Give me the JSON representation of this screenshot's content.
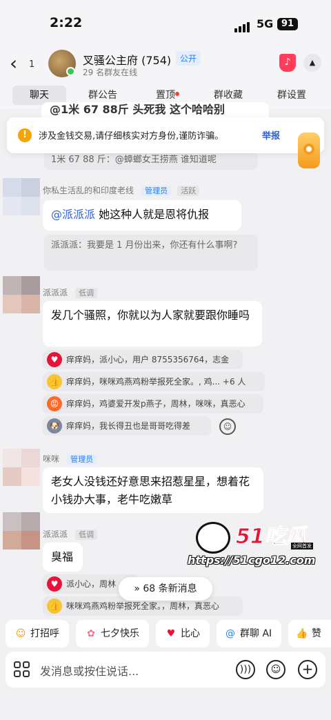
{
  "status_bar": {
    "time": "2:22",
    "network": "5G",
    "battery": "91"
  },
  "header": {
    "back_count": "1",
    "group_name": "叉骚公主府 (754)",
    "public_badge": "公开",
    "online": "29 名群友在线"
  },
  "tabs": [
    {
      "label": "聊天",
      "active": true
    },
    {
      "label": "群公告"
    },
    {
      "label": "置顶",
      "has_dot": true
    },
    {
      "label": "群收藏"
    },
    {
      "label": "群设置"
    }
  ],
  "warning": {
    "text": "涉及金钱交易,请仔细核实对方身份,谨防诈骗。",
    "link": "举报"
  },
  "messages": {
    "top_partial_quote": "1米 67 88 斤：@蟑螂女王捞燕 谁知道呢",
    "top_partial_text": "@1米 67 88斤 头死我 这个哈哈别",
    "m1": {
      "sender": "你私生活乱的和印度老线",
      "tag1": "管理员",
      "tag2": "活跃",
      "mention": "@派派派",
      "text": "她这种人就是恩将仇报",
      "quote": "派派派：我要是 1 月份出来，你还有什么事啊?"
    },
    "m2": {
      "sender": "派派派",
      "tag": "低调",
      "text": "发几个骚照，你就以为人家就要跟你睡吗",
      "reactions": [
        {
          "icon": "heart-icon",
          "text": "痒痒妈，派小心，用户 8755356764，志金"
        },
        {
          "icon": "thumbs-up-icon",
          "text": "痒痒妈，咪咪鸡燕鸡粉举报死全家。, 鸡... +6 人"
        },
        {
          "icon": "angry-face-icon",
          "text": "痒痒妈，鸡婆爱开发p燕子，周林，咪咪，真恶心"
        },
        {
          "icon": "dog-face-icon",
          "text": "痒痒妈，我长得丑也是哥哥吃得差"
        }
      ]
    },
    "m3": {
      "sender": "咪咪",
      "tag": "管理员",
      "text": "老女人没钱还好意思来招惹星星，想着花小钱办大事，老牛吃嫩草"
    },
    "m4": {
      "sender": "派派派",
      "tag": "低调",
      "text": "臭福",
      "reactions": [
        {
          "icon": "heart-icon",
          "text": "派小心，周林"
        },
        {
          "icon": "thumbs-up-icon",
          "text": "咪咪鸡燕鸡粉举报死全家。，周林，真恶心"
        }
      ]
    }
  },
  "new_messages": "68 条新消息",
  "watermark": {
    "brand": "51吃瓜",
    "sub": "全网首发",
    "url": "https://51cgo12.com"
  },
  "quick_actions": [
    "打招呼",
    "七夕快乐",
    "比心",
    "群聊 AI",
    "赞"
  ],
  "composer": {
    "placeholder": "发消息或按住说话..."
  },
  "colors": {
    "accent": "#2b7ef2",
    "warning": "#f5a300",
    "danger": "#e8133a"
  }
}
